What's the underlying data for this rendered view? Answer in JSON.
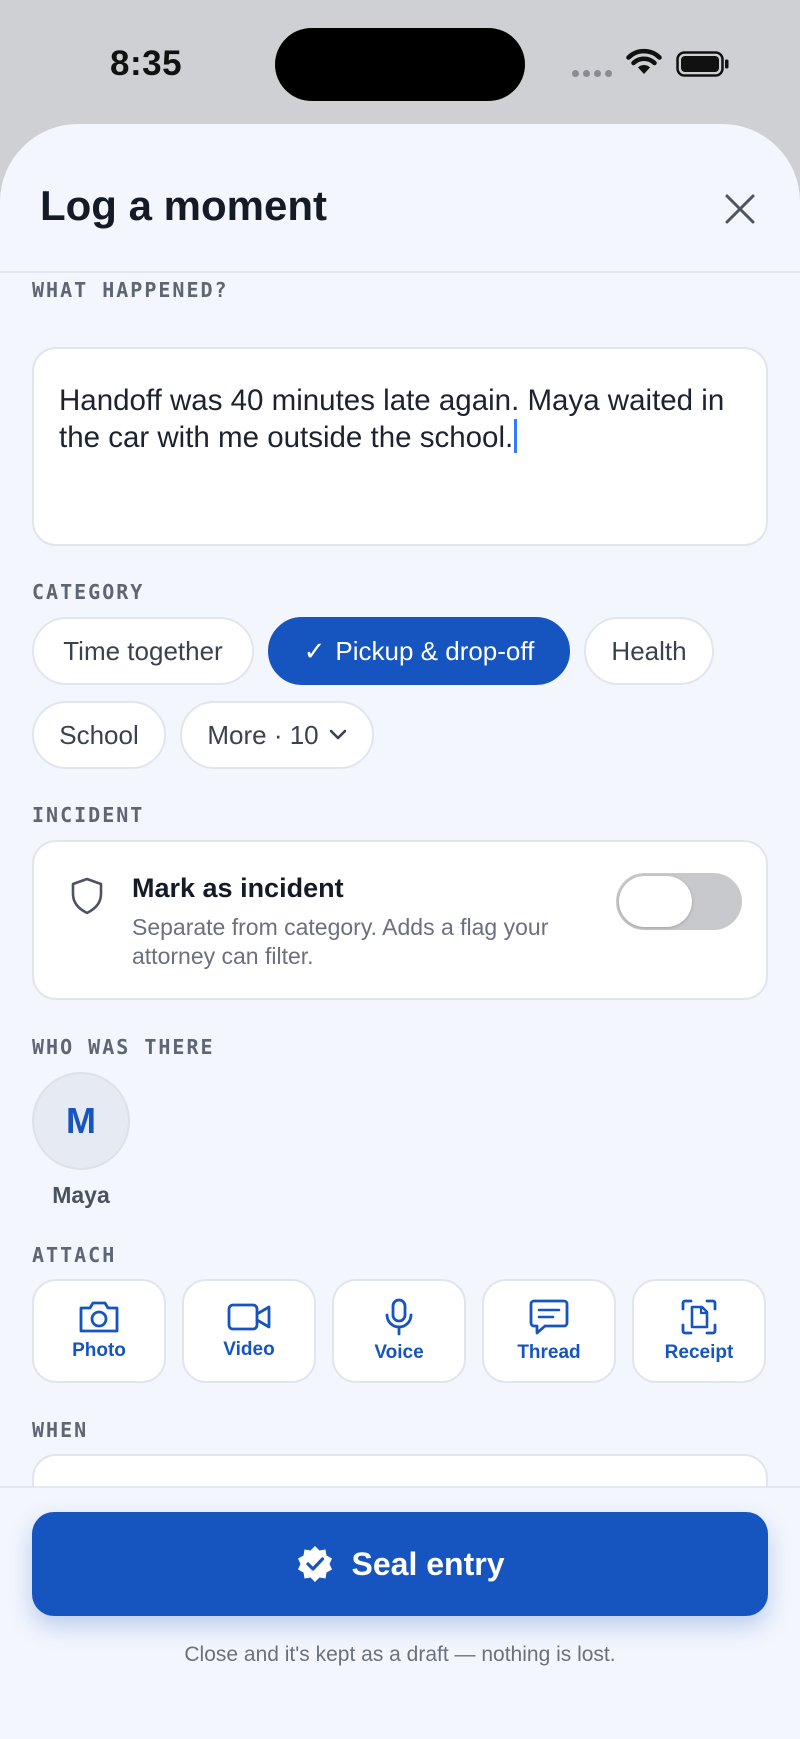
{
  "status_bar": {
    "time": "8:35"
  },
  "header": {
    "title": "Log a moment",
    "close_icon": "close-icon"
  },
  "what_happened": {
    "label": "WHAT HAPPENED?",
    "value": "Handoff was 40 minutes late again. Maya waited in the car with me outside the school."
  },
  "category": {
    "label": "CATEGORY",
    "chips": [
      {
        "label": "Time together",
        "selected": false
      },
      {
        "label": "Pickup & drop-off",
        "selected": true,
        "check": "✓"
      },
      {
        "label": "Health",
        "selected": false
      },
      {
        "label": "School",
        "selected": false
      },
      {
        "label": "More · 10",
        "selected": false,
        "icon": "chevron-down-icon"
      }
    ]
  },
  "incident": {
    "label": "INCIDENT",
    "title": "Mark as incident",
    "description": "Separate from category. Adds a flag your attorney can filter.",
    "toggle_on": false,
    "icon": "shield-icon"
  },
  "who_was_there": {
    "label": "WHO WAS THERE",
    "people": [
      {
        "initial": "M",
        "name": "Maya"
      }
    ]
  },
  "attach": {
    "label": "ATTACH",
    "items": [
      {
        "label": "Photo",
        "icon": "camera-icon"
      },
      {
        "label": "Video",
        "icon": "video-icon"
      },
      {
        "label": "Voice",
        "icon": "microphone-icon"
      },
      {
        "label": "Thread",
        "icon": "message-icon"
      },
      {
        "label": "Receipt",
        "icon": "receipt-scan-icon"
      }
    ]
  },
  "when": {
    "label": "WHEN"
  },
  "footer": {
    "seal_label": "Seal entry",
    "seal_icon": "verified-badge-icon",
    "note": "Close and it's kept as a draft — nothing is lost."
  },
  "colors": {
    "accent": "#1654c0",
    "sheet_background": "#f3f6fd",
    "toggle_off": "#c8c9cc"
  }
}
